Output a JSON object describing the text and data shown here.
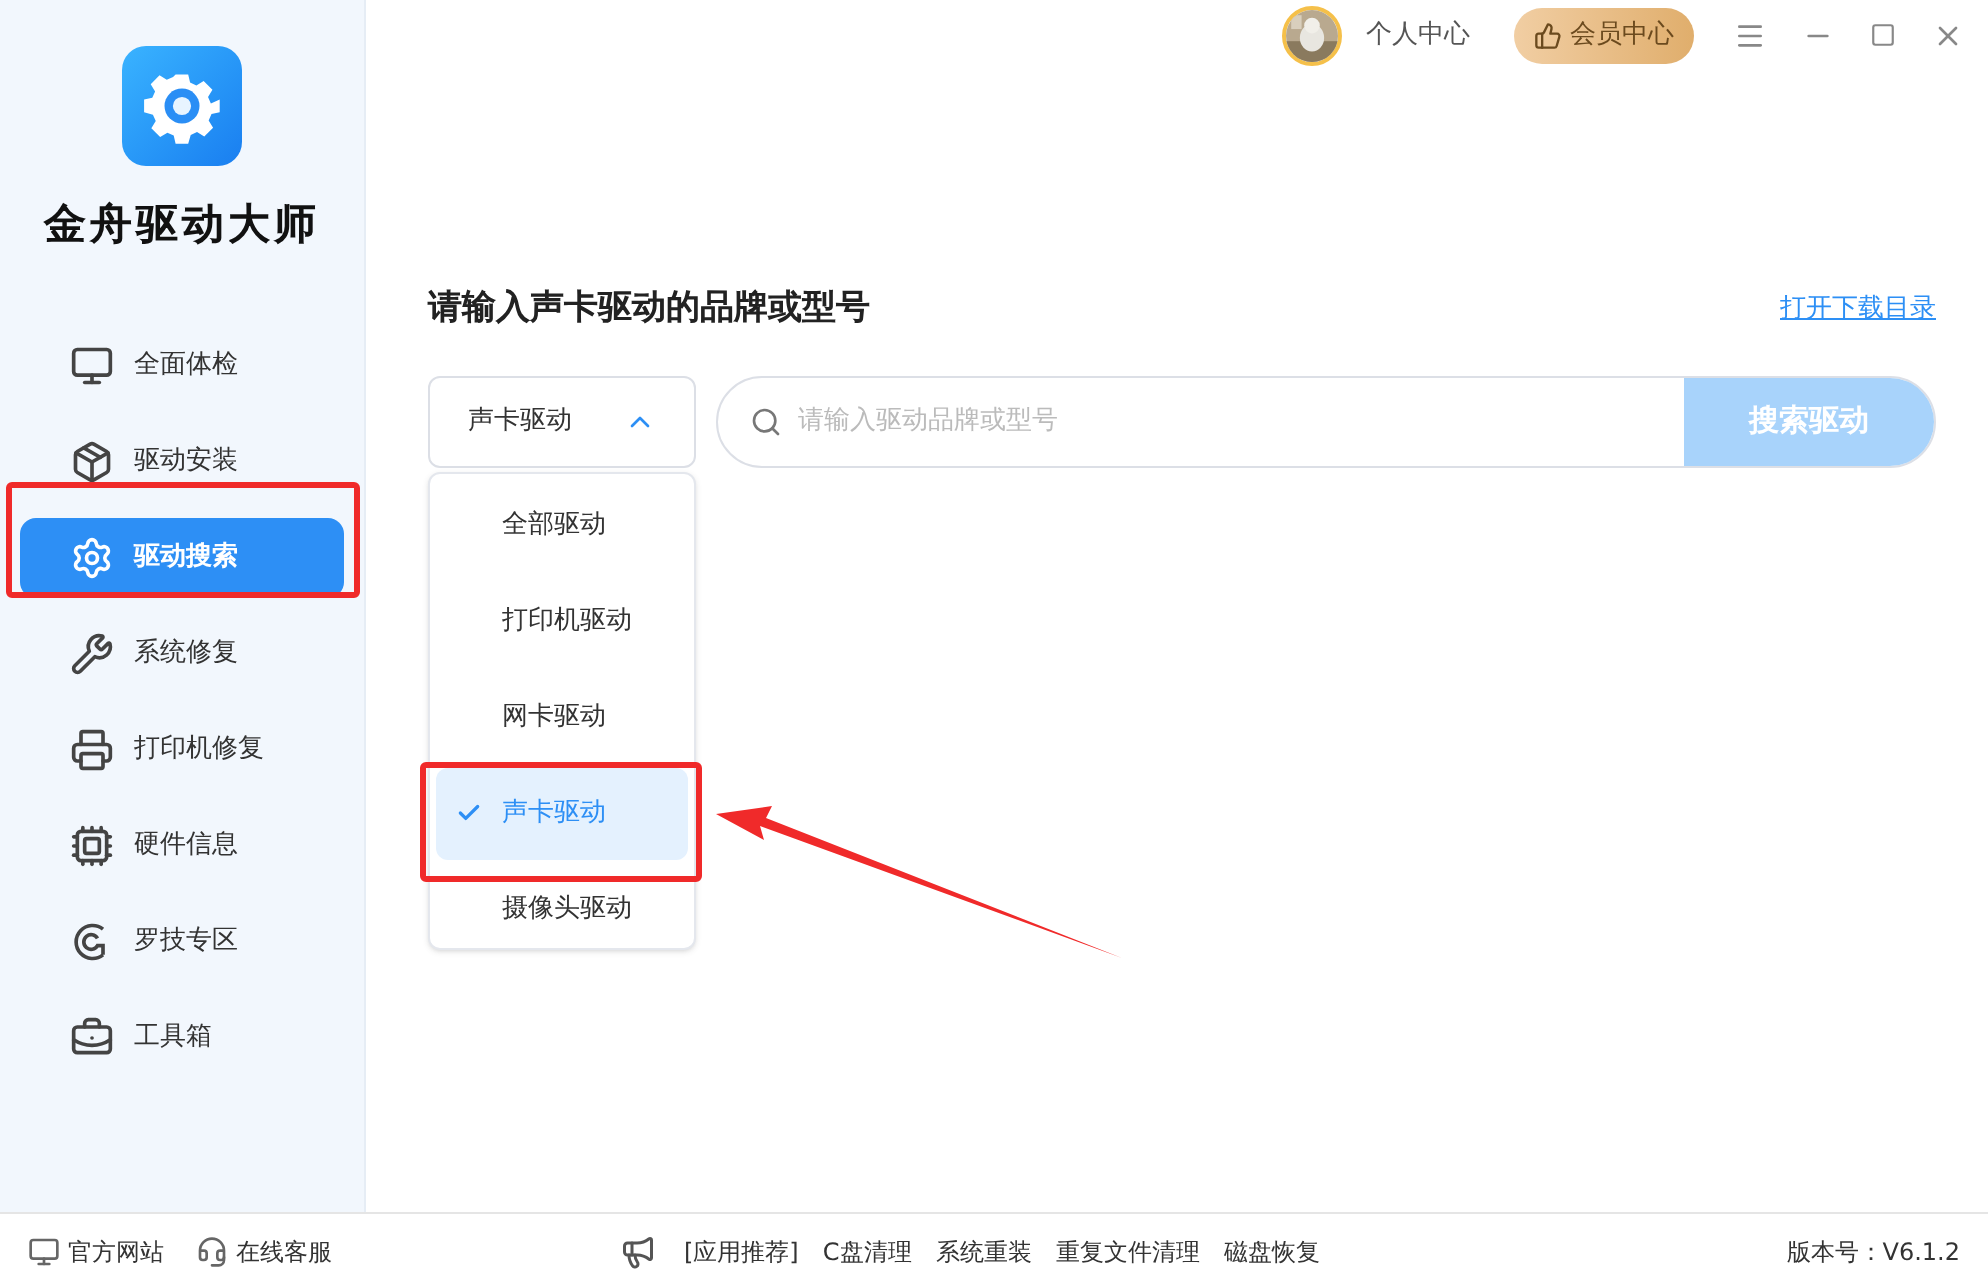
{
  "app": {
    "name": "金舟驱动大师"
  },
  "nav": [
    {
      "label": "全面体检",
      "kind": "monitor",
      "selected": false
    },
    {
      "label": "驱动安装",
      "kind": "box",
      "selected": false
    },
    {
      "label": "驱动搜索",
      "kind": "gear",
      "selected": true
    },
    {
      "label": "系统修复",
      "kind": "tools",
      "selected": false
    },
    {
      "label": "打印机修复",
      "kind": "printer",
      "selected": false
    },
    {
      "label": "硬件信息",
      "kind": "chip",
      "selected": false
    },
    {
      "label": "罗技专区",
      "kind": "logo",
      "selected": false
    },
    {
      "label": "工具箱",
      "kind": "toolbox",
      "selected": false
    }
  ],
  "header": {
    "user": "个人中心",
    "member": "会员中心"
  },
  "search": {
    "title": "请输入声卡驱动的品牌或型号",
    "link": "打开下载目录",
    "category": {
      "value": "声卡驱动",
      "expanded": true
    },
    "options": [
      {
        "label": "全部驱动",
        "selected": false
      },
      {
        "label": "打印机驱动",
        "selected": false
      },
      {
        "label": "网卡驱动",
        "selected": false
      },
      {
        "label": "声卡驱动",
        "selected": true
      },
      {
        "label": "摄像头驱动",
        "selected": false
      }
    ],
    "placeholder": "请输入驱动品牌或型号",
    "button": "搜索驱动"
  },
  "footer": {
    "links": [
      {
        "label": "官方网站",
        "kind": "monitor"
      },
      {
        "label": "在线客服",
        "kind": "headset"
      }
    ],
    "promo_label": "[应用推荐]",
    "promos": [
      "C盘清理",
      "系统重装",
      "重复文件清理",
      "磁盘恢复"
    ],
    "version": "版本号：V6.1.2"
  }
}
